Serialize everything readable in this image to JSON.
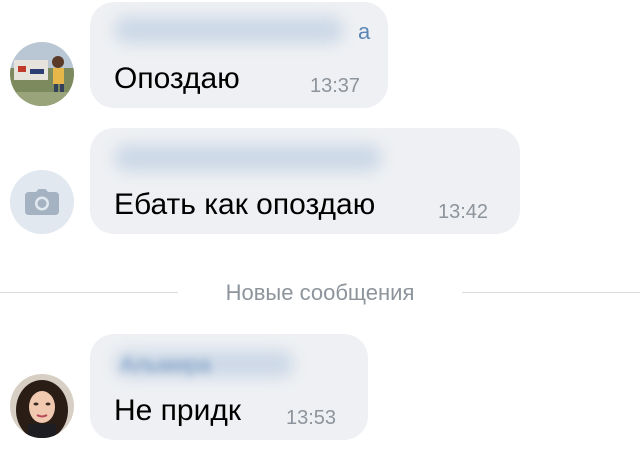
{
  "messages": [
    {
      "sender_visible": "а",
      "text": "Опоздаю",
      "time": "13:37",
      "avatar_icon": "user-photo-avatar"
    },
    {
      "sender_visible": "",
      "text": "Ебать как опоздаю",
      "time": "13:42",
      "avatar_icon": "camera-icon"
    },
    {
      "sender_visible": "Альмира",
      "text": "Не придк",
      "time": "13:53",
      "avatar_icon": "user-photo-avatar"
    }
  ],
  "divider": {
    "label": "Новые сообщения"
  },
  "colors": {
    "bubble": "#eef0f3",
    "time": "#8d949c",
    "sender": "#5b86b5",
    "divider_line": "#d9dde2",
    "camera_avatar_bg": "#e1e8ef"
  }
}
